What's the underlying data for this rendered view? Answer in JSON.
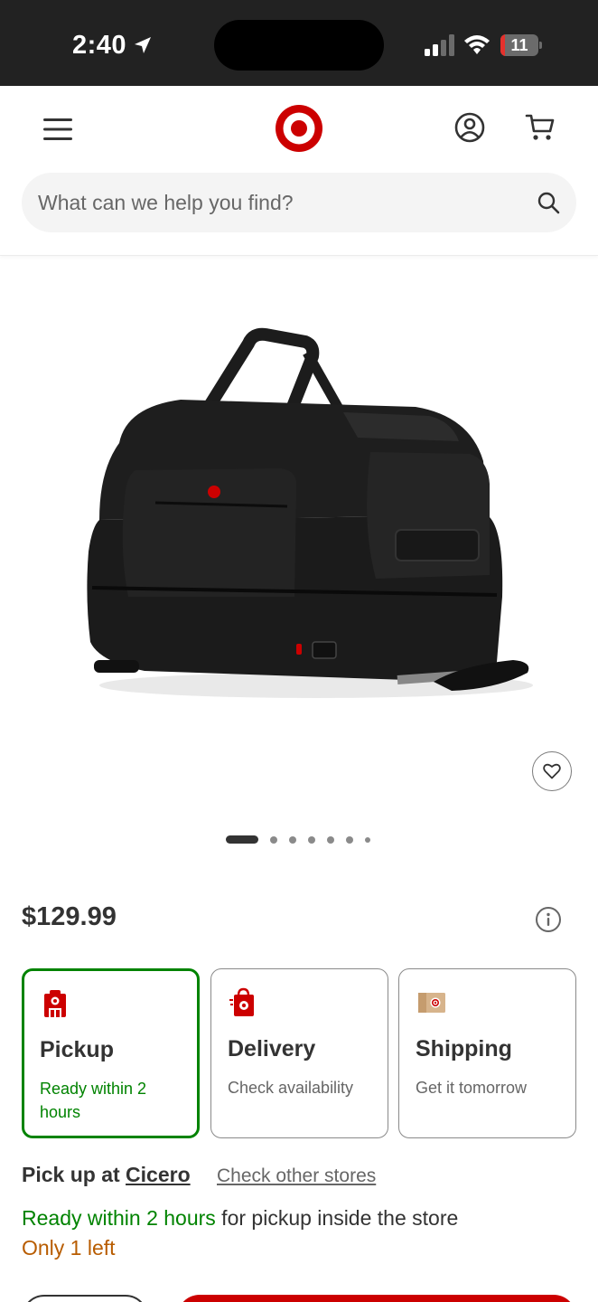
{
  "status_bar": {
    "time": "2:40",
    "battery": "11",
    "battery_level": 0.11,
    "icons": [
      "location-arrow-icon",
      "cellular-signal-icon",
      "wifi-icon",
      "battery-icon"
    ]
  },
  "header": {
    "icons": [
      "menu-icon",
      "target-logo",
      "account-icon",
      "cart-icon"
    ],
    "brand_color": "#cc0000"
  },
  "search": {
    "placeholder": "What can we help you find?",
    "icon": "search-icon"
  },
  "gallery": {
    "image_count": 7,
    "active_index": 0,
    "favorite_icon": "heart-icon"
  },
  "product": {
    "price": "$129.99",
    "info_icon": "info-icon"
  },
  "fulfillment": {
    "options": [
      {
        "title": "Pickup",
        "subtitle": "Ready within 2 hours",
        "icon": "store-pickup-icon",
        "selected": true
      },
      {
        "title": "Delivery",
        "subtitle": "Check availability",
        "icon": "delivery-bag-icon",
        "selected": false
      },
      {
        "title": "Shipping",
        "subtitle": "Get it tomorrow",
        "icon": "shipping-box-icon",
        "selected": false
      }
    ],
    "selected_color": "#008300"
  },
  "pickup": {
    "prefix": "Pick up at ",
    "store": "Cicero",
    "other_stores_link": "Check other stores",
    "ready_highlight": "Ready within 2 hours",
    "ready_rest": " for pickup inside the store",
    "stock": "Only 1 left",
    "stock_color": "#b85c00"
  }
}
